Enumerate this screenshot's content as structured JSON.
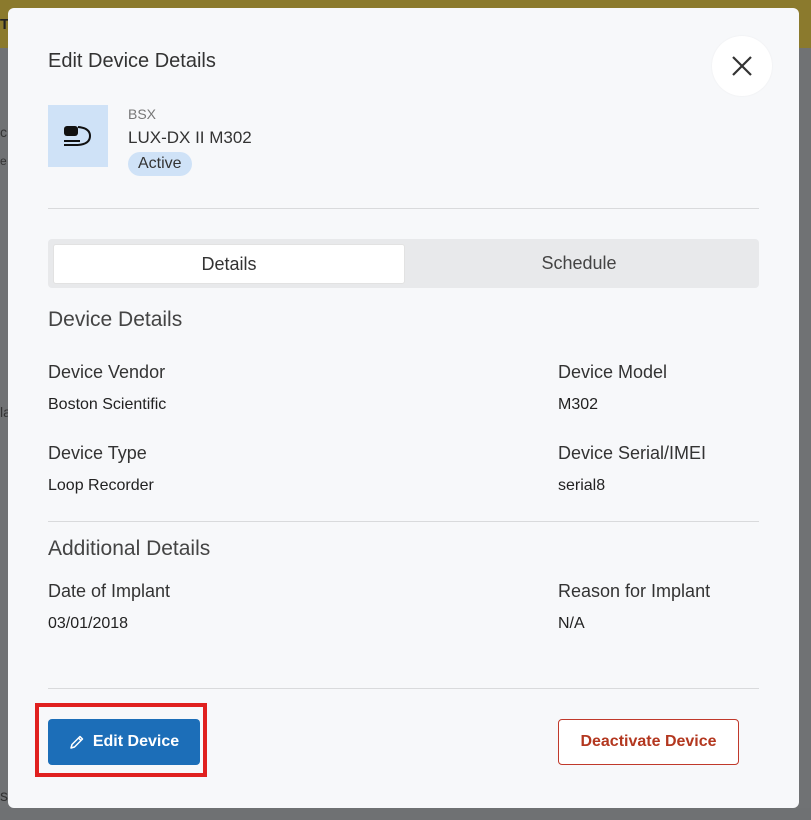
{
  "background": {
    "banner_fragment": "T",
    "left_fragments": [
      "c",
      "e",
      "la"
    ],
    "bottom_fragment": "s"
  },
  "modal": {
    "title": "Edit Device Details",
    "close_icon": "close-icon"
  },
  "device": {
    "vendor_code": "BSX",
    "name": "LUX-DX II M302",
    "status": "Active",
    "thumbnail_icon": "loop-recorder-icon"
  },
  "tabs": [
    {
      "label": "Details",
      "active": true
    },
    {
      "label": "Schedule",
      "active": false
    }
  ],
  "device_details": {
    "title": "Device Details",
    "vendor_label": "Device Vendor",
    "vendor_value": "Boston Scientific",
    "model_label": "Device Model",
    "model_value": "M302",
    "type_label": "Device Type",
    "type_value": "Loop Recorder",
    "serial_label": "Device Serial/IMEI",
    "serial_value": "serial8"
  },
  "additional_details": {
    "title": "Additional Details",
    "implant_date_label": "Date of Implant",
    "implant_date_value": "03/01/2018",
    "reason_label": "Reason for Implant",
    "reason_value": "N/A"
  },
  "actions": {
    "edit_label": "Edit Device",
    "edit_icon": "pencil-icon",
    "deactivate_label": "Deactivate Device"
  },
  "colors": {
    "primary": "#1c6eb8",
    "danger": "#b3371f",
    "badge_bg": "#cfe2f7",
    "highlight": "#e0201f"
  }
}
